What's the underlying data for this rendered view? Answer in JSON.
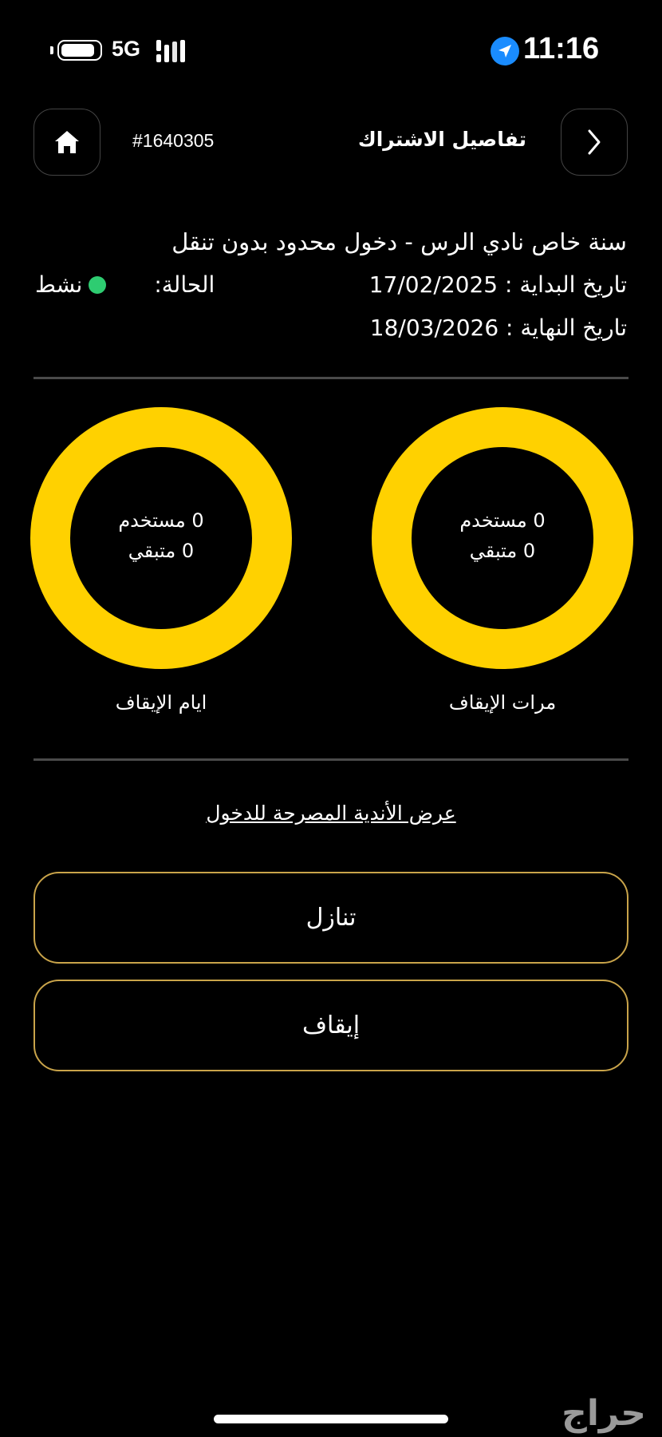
{
  "status_bar": {
    "network": "5G",
    "time": "11:16",
    "battery_level": 0.9
  },
  "header": {
    "subscription_number": "#1640305",
    "title": "تفاصيل الاشتراك"
  },
  "subscription": {
    "plan_name": "سنة خاص نادي الرس - دخول محدود بدون تنقل",
    "start_label": "تاريخ البداية :",
    "start_date": "17/02/2025",
    "end_label": "تاريخ النهاية :",
    "end_date": "18/03/2026",
    "status_label": "الحالة:",
    "status_value": "نشط",
    "status_color": "#2ecc71"
  },
  "freeze": {
    "ring_color": "#ffd100",
    "times": {
      "label": "مرات الإيقاف",
      "used": "0 مستخدم",
      "remaining": "0 متبقي"
    },
    "days": {
      "label": "ايام الإيقاف",
      "used": "0 مستخدم",
      "remaining": "0 متبقي"
    }
  },
  "clubs_link": "عرض الأندية المصرحة للدخول",
  "actions": {
    "cancel_label": "تنازل",
    "pause_label": "إيقاف",
    "border_color": "#c9a44a"
  },
  "watermark": "حراج"
}
